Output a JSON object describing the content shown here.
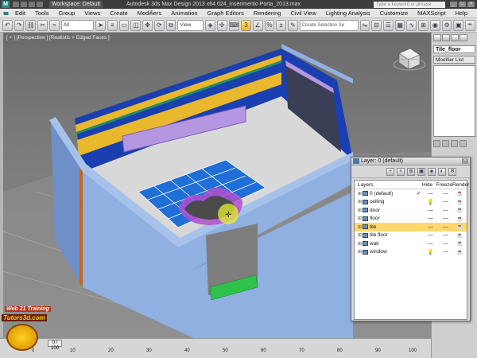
{
  "titlebar": {
    "workspace": "Workspace: Default",
    "title": "Autodesk 3ds Max Design 2013 x64      024_inserimento Porta_2013.max",
    "search_placeholder": "Type a keyword or phrase"
  },
  "menu": {
    "items": [
      "Edit",
      "Tools",
      "Group",
      "Views",
      "Create",
      "Modifiers",
      "Animation",
      "Graph Editors",
      "Rendering",
      "Civil View",
      "Lighting Analysis",
      "Customize",
      "MAXScript",
      "Help"
    ]
  },
  "toolbar": {
    "filter_value": "All",
    "refcoord_value": "View",
    "selection_set_placeholder": "Create Selection Se"
  },
  "viewport": {
    "label": "[ + ] [Perspective ] [Realistic + Edged Faces ]"
  },
  "command_panel": {
    "object_name": "Tile_floor",
    "modifier_list": "Modifier List"
  },
  "layer_dialog": {
    "title": "Layer: 0 (default)",
    "columns": {
      "name": "Layers",
      "hide": "Hide",
      "freeze": "Freeze",
      "render": "Render"
    },
    "layers": [
      {
        "name": "0 (default)",
        "current": "✓",
        "hide": "—",
        "freeze": "—",
        "render": "☕"
      },
      {
        "name": "ceiling",
        "current": "",
        "hide": "💡",
        "freeze": "—",
        "render": "☕"
      },
      {
        "name": "door",
        "current": "",
        "hide": "—",
        "freeze": "—",
        "render": "☕"
      },
      {
        "name": "floor",
        "current": "",
        "hide": "—",
        "freeze": "—",
        "render": "☕"
      },
      {
        "name": "tile",
        "current": "",
        "hide": "—",
        "freeze": "—",
        "render": "☕"
      },
      {
        "name": "tile floor",
        "current": "",
        "hide": "—",
        "freeze": "—",
        "render": "☕"
      },
      {
        "name": "wall",
        "current": "",
        "hide": "—",
        "freeze": "—",
        "render": "☕"
      },
      {
        "name": "window",
        "current": "",
        "hide": "💡",
        "freeze": "—",
        "render": "☕"
      }
    ]
  },
  "timeline": {
    "slider": "0 / 100",
    "ticks": [
      "0",
      "10",
      "20",
      "30",
      "40",
      "50",
      "60",
      "70",
      "80",
      "90",
      "100"
    ]
  },
  "watermark": {
    "line1": "Web 21 Training",
    "line2": "Tutors3d.com"
  },
  "colors": {
    "wall_outer": "#8fb0e0",
    "tile_blue": "#1a3fb0",
    "tile_yellow": "#e9b82c",
    "accent_purple": "#b497e0",
    "active_layer": "#ffd86b"
  }
}
